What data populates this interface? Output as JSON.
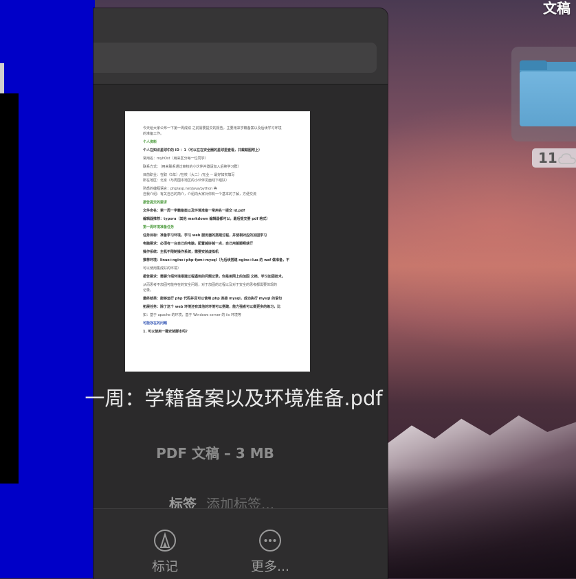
{
  "desktop": {
    "top_right_label": "文稿",
    "folder_badge": "11"
  },
  "pdf_preview": {
    "lines": [
      {
        "text": "今天给大家公布一下第一周成绩 之前需要提交的报告，主要用来学籍备案以及后续学习环境",
        "style": "normal"
      },
      {
        "text": "的准备工作。",
        "style": "normal"
      },
      {
        "text": "个人资料",
        "style": "green"
      },
      {
        "text": "个人在知识星球中的 ID ：1（可以在在安全圈的星球里查看，并截截图附上）",
        "style": "bold"
      },
      {
        "text": "常用名：myhOst（用来区分每一位同学）",
        "style": "normal"
      },
      {
        "text": "联系方式：（用来联系通过审核的小伙伴并邀请加入后续学习群）",
        "style": "normal"
      },
      {
        "text": "目前职业：在职（5年）/在校（大二）/无业 -- 最好如实填写",
        "style": "normal"
      },
      {
        "text": "所在地区：北京（与周围本地区的小伙伴见面线下组队）",
        "style": "normal"
      },
      {
        "text": "熟悉的编程语言：php/asp.net/java/python 等",
        "style": "normal"
      },
      {
        "text": "自我介绍：有关自己的简介，介绍向大家对你有一个基本的了解，方便交流",
        "style": "normal"
      },
      {
        "text": "报告提交的要求",
        "style": "green"
      },
      {
        "text": "文件命名：第一周一学籍备案以及环境准备一常用名一提交 id.pdf",
        "style": "bold"
      },
      {
        "text": "编辑器推荐：typora（其他 markdown 编辑器都可以，最后提交要 pdf 格式）",
        "style": "bold"
      },
      {
        "text": "第一周环境准备任务",
        "style": "green"
      },
      {
        "text": "任务目标：准备学习环境，学习 web 服务器的搭建过程，并使相对应的加固学习",
        "style": "bold"
      },
      {
        "text": "电脑要求：必须有一台自己的电脑，配置越好越一点，自己用着顺畅就行",
        "style": "bold"
      },
      {
        "text": "操作系统：主机不限制操作系统，需要安装虚拟机",
        "style": "bold"
      },
      {
        "text": "推荐环境：linux+nginx+php-fpm+mysql（为后续搭建 nginx+lua 的 waf 做准备，不",
        "style": "bold"
      },
      {
        "text": "可以使用集成好的环境）",
        "style": "normal"
      },
      {
        "text": "报告要求：需要介绍环境搭建过程遇到的问题记录，你是用网上的加固 文档、学习加固技术。",
        "style": "bold"
      },
      {
        "text": "从而思考不加固可能存在的安全问题，对于加固的过程以及对于安全的思考都需要体现的",
        "style": "normal"
      },
      {
        "text": "记录。",
        "style": "normal"
      },
      {
        "text": "最终结果：能够运行 php 代码并且可以使用 php 连接 mysql，成功执行 mysql 的语句",
        "style": "bold"
      },
      {
        "text": "拓展任务：除了这个 web 环境还有其他的环境可以搭建，能力强者可以做更多的练习，比",
        "style": "bold"
      },
      {
        "text": "如：基于 apache 的环境，基于 Windows server 的 iis 环境等",
        "style": "normal"
      },
      {
        "text": "可能存在的问题",
        "style": "blue"
      },
      {
        "text": "1. 可以使用一键安装脚本吗？",
        "style": "bold"
      }
    ]
  },
  "file_info": {
    "title": "一周：学籍备案以及环境准备.pdf",
    "subtitle": "PDF 文稿 – 3 MB"
  },
  "tags": {
    "label": "标签",
    "placeholder": "添加标签..."
  },
  "actions": {
    "markup_label": "标记",
    "more_label": "更多..."
  }
}
